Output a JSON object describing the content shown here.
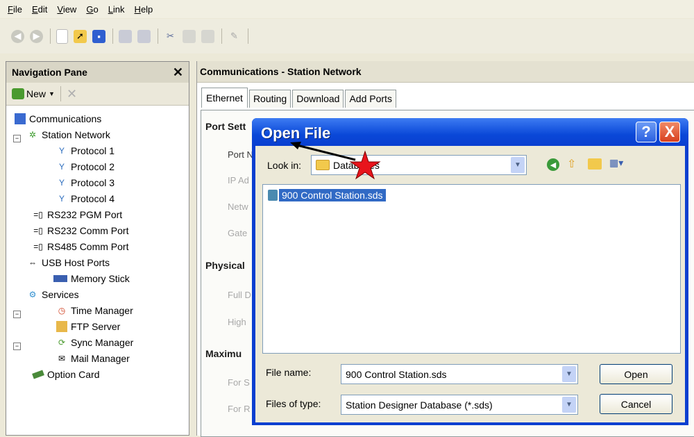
{
  "menubar": {
    "items": [
      {
        "label": "File",
        "ul": "F",
        "rest": "ile"
      },
      {
        "label": "Edit",
        "ul": "E",
        "rest": "dit"
      },
      {
        "label": "View",
        "ul": "V",
        "rest": "iew"
      },
      {
        "label": "Go",
        "ul": "G",
        "rest": "o"
      },
      {
        "label": "Link",
        "ul": "L",
        "rest": "ink"
      },
      {
        "label": "Help",
        "ul": "H",
        "rest": "elp"
      }
    ]
  },
  "navigation_pane": {
    "title": "Navigation Pane",
    "new_label": "New",
    "tree": [
      {
        "label": "Communications",
        "icon": "communications-icon"
      },
      {
        "label": "Station Network",
        "icon": "network-icon"
      },
      {
        "label": "Protocol 1",
        "icon": "protocol-icon"
      },
      {
        "label": "Protocol 2",
        "icon": "protocol-icon"
      },
      {
        "label": "Protocol 3",
        "icon": "protocol-icon"
      },
      {
        "label": "Protocol 4",
        "icon": "protocol-icon"
      },
      {
        "label": "RS232 PGM Port",
        "icon": "serial-port-icon"
      },
      {
        "label": "RS232 Comm Port",
        "icon": "serial-port-icon"
      },
      {
        "label": "RS485 Comm Port",
        "icon": "serial-port-icon"
      },
      {
        "label": "USB Host Ports",
        "icon": "usb-icon"
      },
      {
        "label": "Memory Stick",
        "icon": "memory-stick-icon"
      },
      {
        "label": "Services",
        "icon": "services-icon"
      },
      {
        "label": "Time Manager",
        "icon": "clock-icon"
      },
      {
        "label": "FTP Server",
        "icon": "ftp-icon"
      },
      {
        "label": "Sync Manager",
        "icon": "sync-icon"
      },
      {
        "label": "Mail Manager",
        "icon": "mail-icon"
      },
      {
        "label": "Option Card",
        "icon": "card-icon"
      }
    ]
  },
  "main": {
    "title": "Communications - Station Network",
    "tabs": [
      "Ethernet",
      "Routing",
      "Download",
      "Add Ports"
    ],
    "sections": {
      "port_settings": "Port Sett",
      "physical": "Physical",
      "maximum": "Maximu"
    },
    "fields": {
      "port_name": "Port N",
      "ip_address": "IP Ad",
      "network": "Netw",
      "gateway": "Gate",
      "full_duplex": "Full D",
      "high_speed": "High",
      "for_send": "For S",
      "for_receive": "For R"
    }
  },
  "dialog": {
    "title": "Open File",
    "lookin_label": "Look in:",
    "lookin_value": "Databases",
    "files": [
      "900 Control Station.sds"
    ],
    "filename_label": "File name:",
    "filename_value": "900 Control Station.sds",
    "filetype_label": "Files of type:",
    "filetype_value": "Station Designer Database (*.sds)",
    "open_button": "Open",
    "cancel_button": "Cancel",
    "help_button": "?",
    "close_button": "X"
  },
  "colors": {
    "title_bar_blue": "#0a3fd0",
    "selection_blue": "#316ac5",
    "close_red": "#e45a3a",
    "annotation_star": "#e8141c"
  }
}
